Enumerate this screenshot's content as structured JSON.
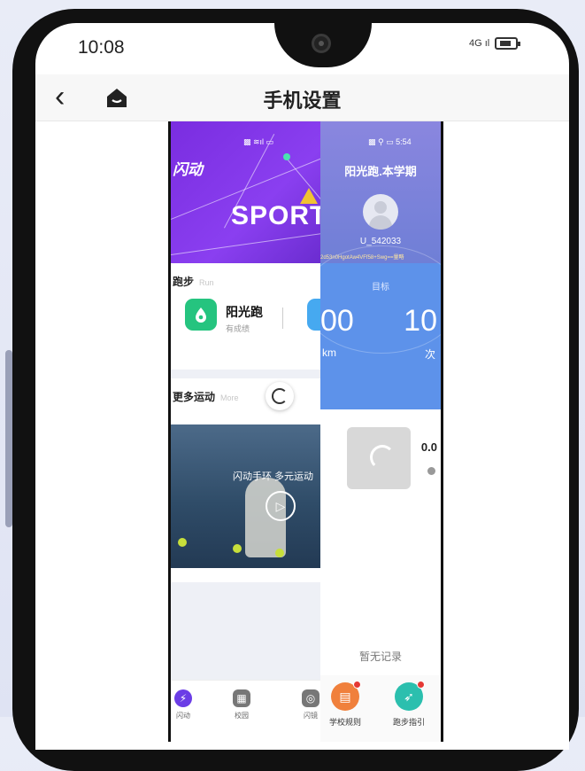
{
  "status_bar": {
    "time": "10:08",
    "signal": "4G ıl",
    "battery": "battery-icon"
  },
  "titlebar": {
    "back": "‹",
    "title": "手机设置"
  },
  "left_app": {
    "status": "▩ ≋ıl ▭",
    "brand": "闪动",
    "banner_text": "SPORT",
    "run_section": {
      "title": "跑步",
      "subtitle": "Run"
    },
    "run_app": {
      "name": "阳光跑",
      "sub": "有成绩"
    },
    "more_section": {
      "title": "更多运动",
      "subtitle": "More"
    },
    "video_caption": "闪动手环  多元运动",
    "nav": [
      {
        "label": "闪动",
        "icon": "lightning-icon",
        "color": "#6b3de6"
      },
      {
        "label": "校园",
        "icon": "building-icon",
        "color": "#777777"
      },
      {
        "label": "闪镜",
        "icon": "camera-icon",
        "color": "#777777"
      }
    ]
  },
  "right_app": {
    "status": "▩ ⚲ ▭ 5:54",
    "title": "阳光跑.本学期",
    "user_id": "U_542033",
    "hash": "2d53n0HgotAw4VFf58+Swg==量略",
    "goal_label": "目标",
    "goal_km": "00",
    "goal_count": "10",
    "unit_km": "km",
    "unit_count": "次",
    "score": "0.0",
    "empty_text": "暂无记录",
    "actions": [
      {
        "label": "学校规则",
        "icon": "rules-icon",
        "color": "#f0803c"
      },
      {
        "label": "跑步指引",
        "icon": "compass-icon",
        "color": "#2bbfae"
      }
    ]
  },
  "colors": {
    "purple_banner": "#7a2de0",
    "goal_blue": "#5d92ea",
    "run_green": "#25c47f"
  }
}
